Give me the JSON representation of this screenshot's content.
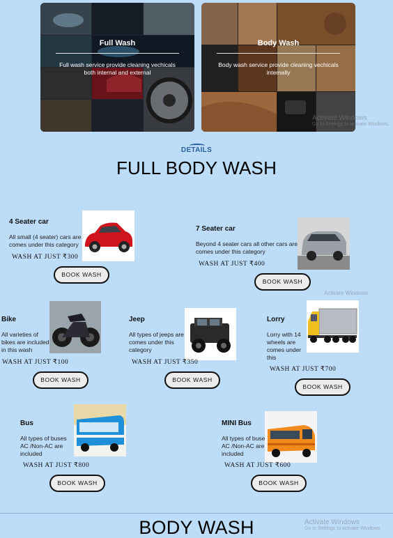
{
  "hero": {
    "full": {
      "title": "Full Wash",
      "description": "Full wash service provide cleaning vechicals both internal and external"
    },
    "body": {
      "title": "Body Wash",
      "description": "Body wash service provide cleaning vechicals internally"
    }
  },
  "section": {
    "kicker": "DETAILS",
    "title": "FULL BODY WASH",
    "next_title": "BODY WASH"
  },
  "cards": {
    "four_seater": {
      "title": "4 Seater car",
      "description": "All small (4 seater) cars are comes under this category",
      "price": "WASH AT JUST ₹300",
      "button": "BOOK WASH",
      "image_icon": "red-hatchback-car"
    },
    "seven_seater": {
      "title": "7 Seater car",
      "description": "Beyond 4 seater cars all other cars are comes under this category",
      "price": "WASH AT JUST ₹400",
      "button": "BOOK WASH",
      "image_icon": "silver-mpv-car"
    },
    "bike": {
      "title": "Bike",
      "description": "All varieties of bikes are included in this wash",
      "price": "WASH AT JUST ₹100",
      "button": "BOOK WASH",
      "image_icon": "motorcycle"
    },
    "jeep": {
      "title": "Jeep",
      "description": "All types of jeeps are comes under this category",
      "price": "WASH AT JUST ₹350",
      "button": "BOOK WASH",
      "image_icon": "black-jeep"
    },
    "lorry": {
      "title": "Lorry",
      "description": "Lorry with 14 wheels are comes under this",
      "price": "WASH AT JUST ₹700",
      "button": "BOOK WASH",
      "image_icon": "yellow-lorry"
    },
    "bus": {
      "title": "Bus",
      "description": "All types of buses AC /Non-AC are included",
      "price": "WASH AT JUST ₹800",
      "button": "BOOK WASH",
      "image_icon": "blue-bus"
    },
    "mini_bus": {
      "title": "MINI Bus",
      "description": "All types of buses AC /Non-AC are included",
      "price": "WASH AT JUST ₹600",
      "button": "BOOK WASH",
      "image_icon": "orange-mini-bus"
    }
  },
  "watermark": {
    "title": "Activate Windows",
    "subtitle": "Go to Settings to activate Windows."
  },
  "colors": {
    "background": "#bcdcf7",
    "accent": "#2a5f9e",
    "button_bg": "#ececec"
  }
}
